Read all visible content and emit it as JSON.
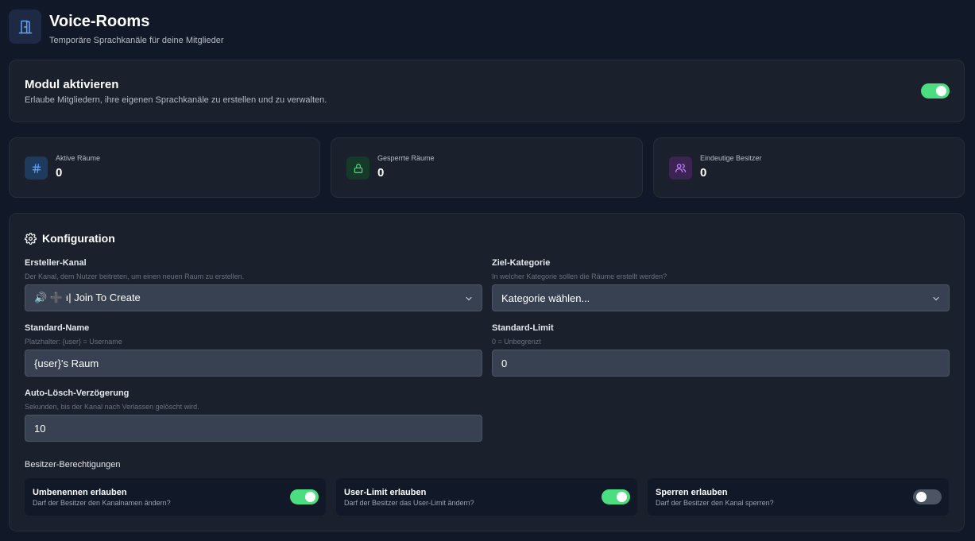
{
  "header": {
    "title": "Voice-Rooms",
    "subtitle": "Temporäre Sprachkanäle für deine Mitglieder",
    "icon": "door-icon"
  },
  "module": {
    "title": "Modul aktivieren",
    "description": "Erlaube Mitgliedern, ihre eigenen Sprachkanäle zu erstellen und zu verwalten.",
    "enabled": true
  },
  "stats": [
    {
      "label": "Aktive Räume",
      "value": "0",
      "icon": "hash-icon",
      "color": "#60a5fa"
    },
    {
      "label": "Gesperrte Räume",
      "value": "0",
      "icon": "lock-icon",
      "color": "#4ade80"
    },
    {
      "label": "Eindeutige Besitzer",
      "value": "0",
      "icon": "users-icon",
      "color": "#c084fc"
    }
  ],
  "config": {
    "title": "Konfiguration",
    "creator_channel": {
      "label": "Ersteller-Kanal",
      "help": "Der Kanal, dem Nutzer beitreten, um einen neuen Raum zu erstellen.",
      "value": "🔊 ➕ ı| Join To Create"
    },
    "target_category": {
      "label": "Ziel-Kategorie",
      "help": "In welcher Kategorie sollen die Räume erstellt werden?",
      "value": "Kategorie wählen..."
    },
    "default_name": {
      "label": "Standard-Name",
      "help": "Platzhalter: {user} = Username",
      "value": "{user}'s Raum"
    },
    "default_limit": {
      "label": "Standard-Limit",
      "help": "0 = Unbegrenzt",
      "value": "0"
    },
    "auto_delete": {
      "label": "Auto-Lösch-Verzögerung",
      "help": "Sekunden, bis der Kanal nach Verlassen gelöscht wird.",
      "value": "10"
    },
    "permissions_heading": "Besitzer-Berechtigungen",
    "permissions": [
      {
        "title": "Umbenennen erlauben",
        "description": "Darf der Besitzer den Kanalnamen ändern?",
        "enabled": true
      },
      {
        "title": "User-Limit erlauben",
        "description": "Darf der Besitzer das User-Limit ändern?",
        "enabled": true
      },
      {
        "title": "Sperren erlauben",
        "description": "Darf der Besitzer den Kanal sperren?",
        "enabled": false
      }
    ]
  },
  "colors": {
    "accent_green": "#4ade80",
    "background": "#111827",
    "card": "#1a202c"
  }
}
